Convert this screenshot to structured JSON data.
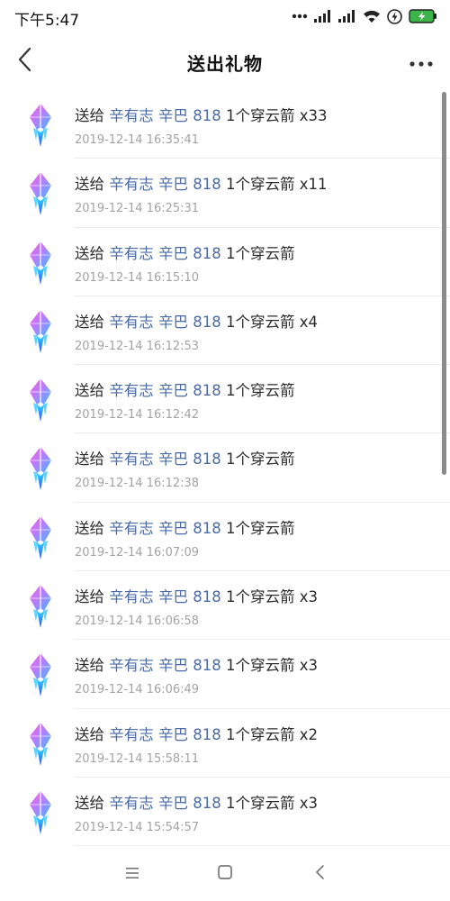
{
  "status_bar": {
    "time": "下午5:47",
    "icons": [
      "more-dots-icon",
      "signal-icon",
      "signal-icon",
      "wifi-icon",
      "lightning-icon",
      "battery-charging-icon"
    ]
  },
  "header": {
    "title": "送出礼物",
    "back_icon": "chevron-left-icon",
    "more_icon": "more-horizontal-icon"
  },
  "colors": {
    "name_link": "#4a6ba7",
    "timestamp": "#a3a3a3",
    "text": "#2b2b2b"
  },
  "gift_records": [
    {
      "action": "送给",
      "recipient": "辛有志 辛巴 818",
      "gift": "1个穿云箭 x33",
      "time": "2019-12-14 16:35:41"
    },
    {
      "action": "送给",
      "recipient": "辛有志 辛巴 818",
      "gift": "1个穿云箭 x11",
      "time": "2019-12-14 16:25:31"
    },
    {
      "action": "送给",
      "recipient": "辛有志 辛巴 818",
      "gift": "1个穿云箭",
      "time": "2019-12-14 16:15:10"
    },
    {
      "action": "送给",
      "recipient": "辛有志 辛巴 818",
      "gift": "1个穿云箭 x4",
      "time": "2019-12-14 16:12:53"
    },
    {
      "action": "送给",
      "recipient": "辛有志 辛巴 818",
      "gift": "1个穿云箭",
      "time": "2019-12-14 16:12:42"
    },
    {
      "action": "送给",
      "recipient": "辛有志 辛巴 818",
      "gift": "1个穿云箭",
      "time": "2019-12-14 16:12:38"
    },
    {
      "action": "送给",
      "recipient": "辛有志 辛巴 818",
      "gift": "1个穿云箭",
      "time": "2019-12-14 16:07:09"
    },
    {
      "action": "送给",
      "recipient": "辛有志 辛巴 818",
      "gift": "1个穿云箭 x3",
      "time": "2019-12-14 16:06:58"
    },
    {
      "action": "送给",
      "recipient": "辛有志 辛巴 818",
      "gift": "1个穿云箭 x3",
      "time": "2019-12-14 16:06:49"
    },
    {
      "action": "送给",
      "recipient": "辛有志 辛巴 818",
      "gift": "1个穿云箭 x2",
      "time": "2019-12-14 15:58:11"
    },
    {
      "action": "送给",
      "recipient": "辛有志 辛巴 818",
      "gift": "1个穿云箭 x3",
      "time": "2019-12-14 15:54:57"
    }
  ],
  "nav_bar": {
    "icons": [
      "menu-icon",
      "home-square-icon",
      "back-triangle-icon"
    ]
  }
}
